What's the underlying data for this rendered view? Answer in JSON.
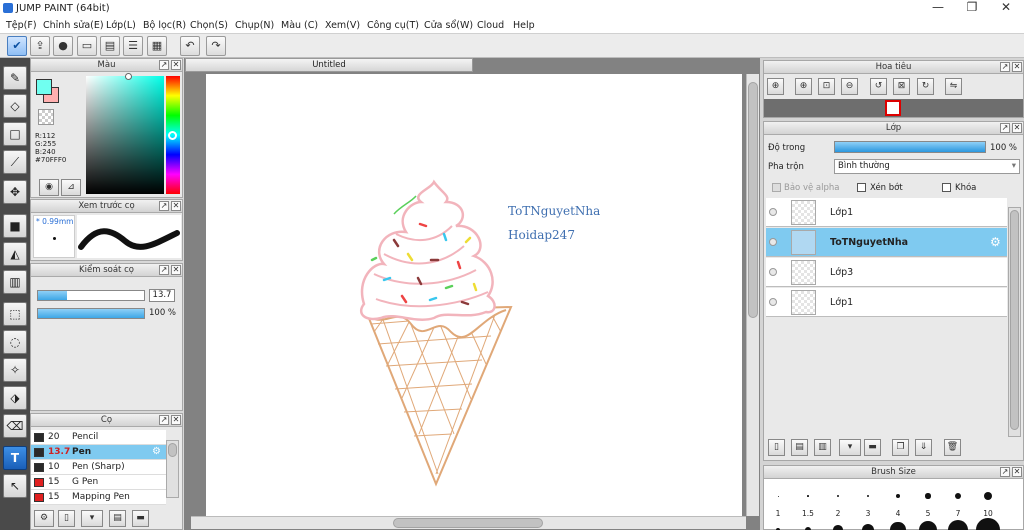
{
  "app": {
    "title": "JUMP PAINT (64bit)",
    "minimize": "—",
    "maximize": "❐",
    "close": "✕"
  },
  "menu": [
    "Tệp(F)",
    "Chỉnh sửa(E)",
    "Lớp(L)",
    "Bộ lọc(R)",
    "Chọn(S)",
    "Chụp(N)",
    "Màu (C)",
    "Xem(V)",
    "Công cụ(T)",
    "Cửa sổ(W)",
    "Cloud",
    "Help"
  ],
  "toolbar": {
    "icons": [
      "check-icon",
      "export-icon",
      "chat-icon",
      "comment-icon",
      "page-icon",
      "list-icon",
      "grid-edit-icon",
      "undo-icon",
      "redo-icon"
    ]
  },
  "color_panel": {
    "title": "Màu",
    "r": "R:112",
    "g": "G:255",
    "b": "B:240",
    "hex": "#70FFF0",
    "fg": "#70FFF0",
    "bg": "#FFB0B0"
  },
  "brush_preview": {
    "title": "Xem trước cọ",
    "size": "* 0.99mm"
  },
  "brush_control": {
    "title": "Kiểm soát cọ",
    "size_value": 13.7,
    "size_label": "13.7",
    "opacity_percent": 100,
    "opacity_label": "100 %"
  },
  "brush_list": {
    "title": "Cọ",
    "items": [
      {
        "size": "20",
        "name": "Pencil",
        "color": "#2a2a2a"
      },
      {
        "size": "13.7",
        "name": "Pen",
        "color": "#2a2a2a",
        "selected": true
      },
      {
        "size": "10",
        "name": "Pen (Sharp)",
        "color": "#2a2a2a"
      },
      {
        "size": "15",
        "name": "G Pen",
        "color": "#e02020"
      },
      {
        "size": "15",
        "name": "Mapping Pen",
        "color": "#e02020"
      }
    ]
  },
  "document": {
    "tab": "Untitled",
    "text1": "ToTNguyetNha",
    "text2": "Hoidap247"
  },
  "navigator": {
    "title": "Hoa tiêu"
  },
  "layer_panel": {
    "title": "Lớp",
    "opacity_label": "Độ trong",
    "opacity_value": "100 %",
    "opacity_percent": 100,
    "blend_label": "Pha trộn",
    "blend_value": "Bình thường",
    "protect_alpha": "Bảo vệ alpha",
    "clipping": "Xén bớt",
    "lock": "Khóa",
    "layers": [
      {
        "name": "Lớp1",
        "selected": false
      },
      {
        "name": "ToTNguyetNha",
        "selected": true
      },
      {
        "name": "Lớp3",
        "selected": false
      },
      {
        "name": "Lớp1",
        "selected": false
      }
    ]
  },
  "brush_size": {
    "title": "Brush Size",
    "labels": [
      "1",
      "1.5",
      "2",
      "3",
      "4",
      "5",
      "7",
      "10"
    ]
  }
}
